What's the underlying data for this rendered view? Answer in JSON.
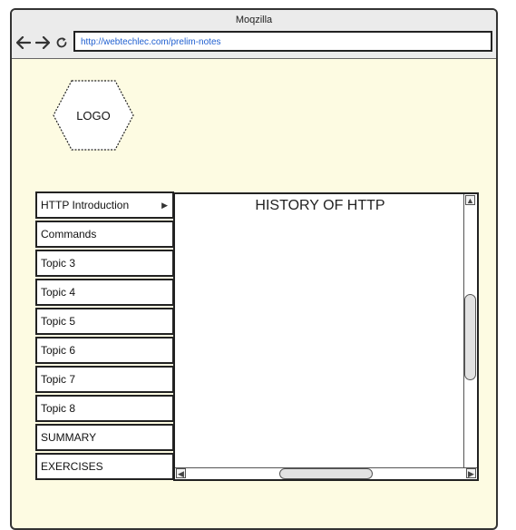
{
  "window": {
    "title": "Moqzilla"
  },
  "toolbar": {
    "back_icon": "arrow-left-icon",
    "forward_icon": "arrow-right-icon",
    "reload_icon": "reload-icon",
    "url": "http://webtechlec.com/prelim-notes"
  },
  "logo": {
    "label": "LOGO"
  },
  "menu": {
    "items": [
      {
        "label": "HTTP Introduction",
        "has_submenu": true
      },
      {
        "label": "Commands"
      },
      {
        "label": "Topic 3"
      },
      {
        "label": "Topic 4"
      },
      {
        "label": "Topic 5"
      },
      {
        "label": "Topic 6"
      },
      {
        "label": "Topic 7"
      },
      {
        "label": "Topic 8"
      },
      {
        "label": "SUMMARY"
      },
      {
        "label": "EXERCISES"
      }
    ]
  },
  "content": {
    "title": "HISTORY OF HTTP"
  },
  "colors": {
    "page_bg": "#fdfbe2",
    "url_text": "#1f5fd0",
    "border": "#222222"
  }
}
